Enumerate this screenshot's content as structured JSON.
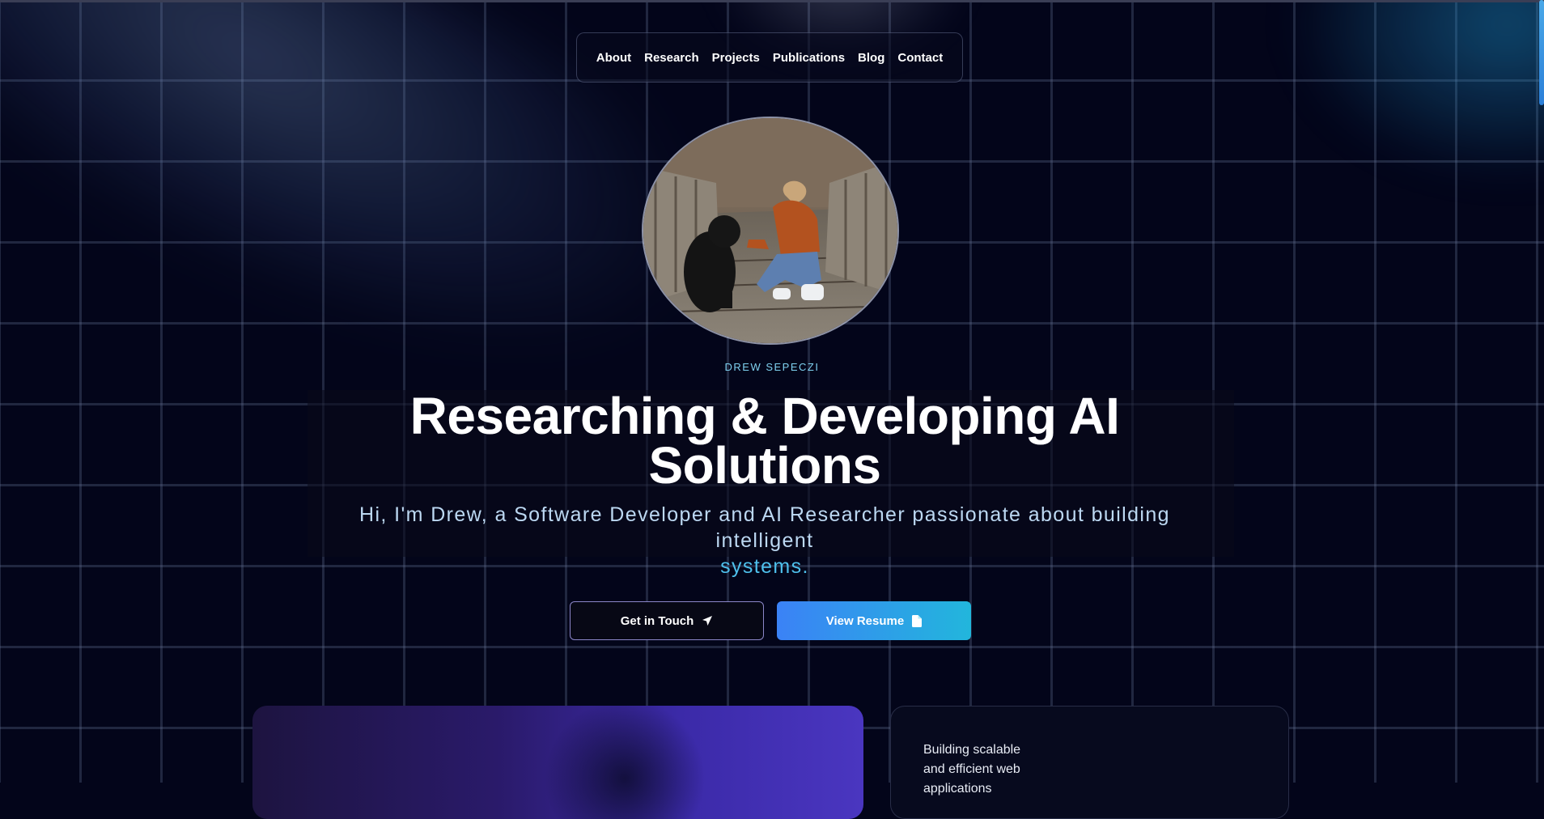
{
  "nav": {
    "items": [
      "About",
      "Research",
      "Projects",
      "Publications",
      "Blog",
      "Contact"
    ]
  },
  "hero": {
    "kicker": "DREW SEPECZI",
    "headline_line1": "Researching & Developing AI",
    "headline_line2": "Solutions",
    "subline_main": "Hi, I'm Drew, a Software Developer and AI Researcher passionate about building intelligent",
    "subline_highlight": "systems."
  },
  "buttons": {
    "contact_label": "Get in Touch",
    "contact_icon": "send-arrow-icon",
    "resume_label": "View Resume",
    "resume_icon": "document-icon"
  },
  "cards": {
    "right_text": "Building scalable and efficient web applications"
  },
  "colors": {
    "background": "#03051a",
    "accent_cyan": "#4ec0ec",
    "button_gradient_start": "#3b82f6",
    "button_gradient_end": "#22b6dc"
  }
}
